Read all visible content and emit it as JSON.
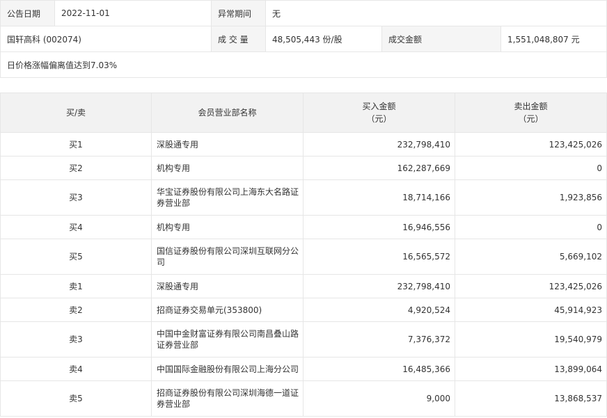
{
  "info": {
    "announce_date_label": "公告日期",
    "announce_date": "2022-11-01",
    "abnormal_period_label": "异常期间",
    "abnormal_period": "无",
    "stock": "国轩高科 (002074)",
    "volume_label": "成 交 量",
    "volume": "48,505,443 份/股",
    "amount_label": "成交金额",
    "amount": "1,551,048,807 元",
    "reason": "日价格涨幅偏离值达到7.03%"
  },
  "table": {
    "headers": {
      "side": "买/卖",
      "dept": "会员营业部名称",
      "buy_line1": "买入金额",
      "buy_line2": "（元）",
      "sell_line1": "卖出金额",
      "sell_line2": "（元）"
    },
    "rows": [
      {
        "side": "买1",
        "dept": "深股通专用",
        "buy": "232,798,410",
        "sell": "123,425,026"
      },
      {
        "side": "买2",
        "dept": "机构专用",
        "buy": "162,287,669",
        "sell": "0"
      },
      {
        "side": "买3",
        "dept": "华宝证券股份有限公司上海东大名路证券营业部",
        "buy": "18,714,166",
        "sell": "1,923,856"
      },
      {
        "side": "买4",
        "dept": "机构专用",
        "buy": "16,946,556",
        "sell": "0"
      },
      {
        "side": "买5",
        "dept": "国信证券股份有限公司深圳互联网分公司",
        "buy": "16,565,572",
        "sell": "5,669,102"
      },
      {
        "side": "卖1",
        "dept": "深股通专用",
        "buy": "232,798,410",
        "sell": "123,425,026"
      },
      {
        "side": "卖2",
        "dept": "招商证券交易单元(353800)",
        "buy": "4,920,524",
        "sell": "45,914,923"
      },
      {
        "side": "卖3",
        "dept": "中国中金财富证券有限公司南昌叠山路证券营业部",
        "buy": "7,376,372",
        "sell": "19,540,979"
      },
      {
        "side": "卖4",
        "dept": "中国国际金融股份有限公司上海分公司",
        "buy": "16,485,366",
        "sell": "13,899,064"
      },
      {
        "side": "卖5",
        "dept": "招商证券股份有限公司深圳海德一道证券营业部",
        "buy": "9,000",
        "sell": "13,868,537"
      }
    ]
  }
}
